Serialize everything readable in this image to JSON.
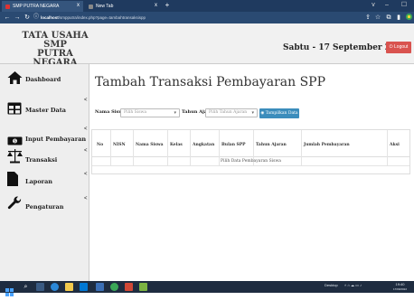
{
  "browser": {
    "tabs": [
      {
        "title": "SMP PUTRA NEGARA",
        "close": "x"
      },
      {
        "title": "New Tab",
        "close": "x"
      }
    ],
    "new_tab": "+",
    "window_controls": [
      "v",
      "–",
      "☐"
    ],
    "url": {
      "host": "localhost",
      "path": "/smpputra/index.php?page=tambahtransaksispp"
    }
  },
  "header": {
    "brand_line1": "TATA USAHA SMP",
    "brand_line2": "PUTRA NEGARA",
    "date": "Sabtu - 17 September 2022",
    "logout_label": "Logout"
  },
  "sidebar": {
    "items": [
      {
        "label": "Dashboard",
        "icon": "home-icon"
      },
      {
        "label": "Master Data",
        "icon": "table-icon",
        "chevron": "<"
      },
      {
        "label": "Input Pembayaran",
        "icon": "money-icon",
        "chevron": "<"
      },
      {
        "label": "Transaksi",
        "icon": "balance-scale-icon",
        "chevron": "<"
      },
      {
        "label": "Laporan",
        "icon": "file-icon",
        "chevron": "<"
      },
      {
        "label": "Pengaturan",
        "icon": "wrench-icon",
        "chevron": "<"
      }
    ]
  },
  "main": {
    "title": "Tambah Transaksi Pembayaran SPP",
    "form": {
      "siswa_label": "Nama Siswa",
      "siswa_placeholder": "Pilih Siswa",
      "tahun_label": "Tahun Ajaran",
      "tahun_placeholder": "Pilih Tahun Ajaran",
      "show_button": "Tampilkan Data"
    },
    "table": {
      "headers": [
        "No",
        "NISN",
        "Nama Siswa",
        "Kelas",
        "Angkatan",
        "Bulan SPP",
        "Tahun Ajaran",
        "Jumlah Pembayaran",
        "Aksi"
      ],
      "empty_message": "Pilih Data Pembayaran Siswa"
    }
  },
  "taskbar": {
    "tray_label": "Desktop",
    "time": "19:40",
    "date": "17/09/2022"
  },
  "colors": {
    "browser_tabbar": "#1f3a5f",
    "logout": "#d9534f",
    "primary_button": "#3c8dbc",
    "sidebar_bg": "#eeeeee"
  }
}
